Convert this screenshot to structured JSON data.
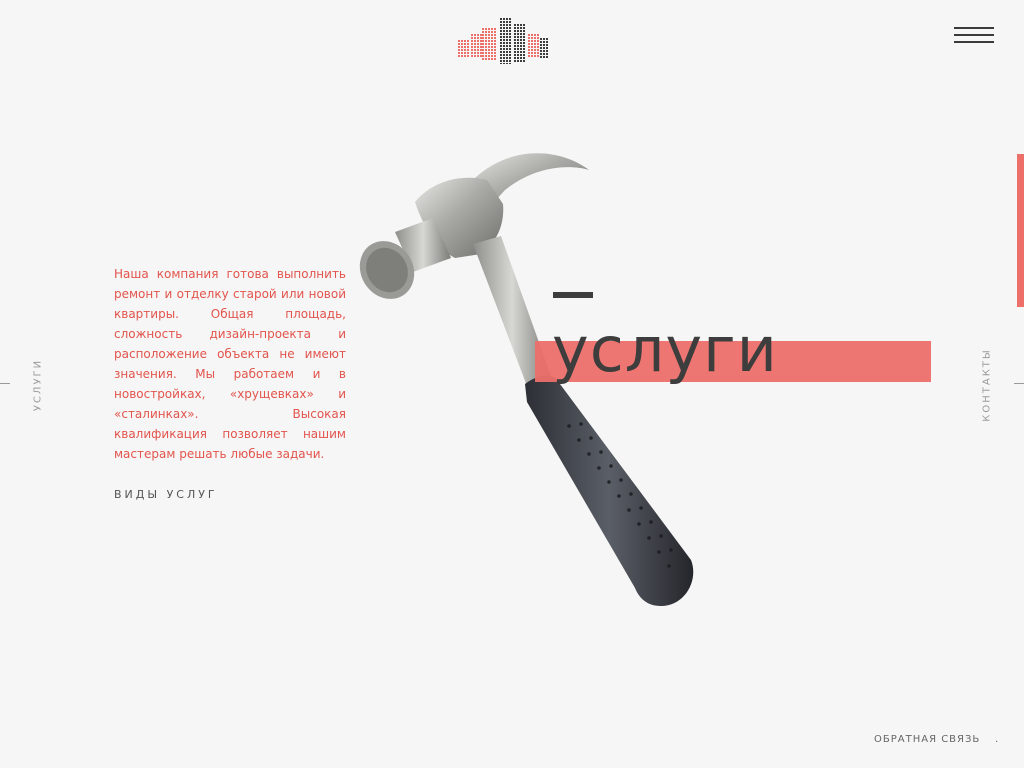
{
  "header": {
    "logo_icon": "buildings-logo-icon",
    "menu_icon": "hamburger-menu-icon"
  },
  "sidebar": {
    "left_label": "Услуги",
    "right_label": "Контакты"
  },
  "main": {
    "title": "услуги",
    "description": "Наша компания готова выполнить ремонт и отделку старой или новой квартиры. Общая площадь, сложность дизайн-проекта и расположение объекта не имеют значения. Мы работаем и в новостройках, «хрущевках» и «сталинках». Высокая квалификация позволяет нашим мастерам решать любые задачи.",
    "services_link": "Виды услуг",
    "image": "hammer-image"
  },
  "footer": {
    "feedback": "Обратная связь",
    "dot": "."
  },
  "colors": {
    "accent": "#ec6f6a",
    "accent_text": "#e2544c",
    "dark": "#3d3d3d",
    "background": "#f6f6f6"
  }
}
